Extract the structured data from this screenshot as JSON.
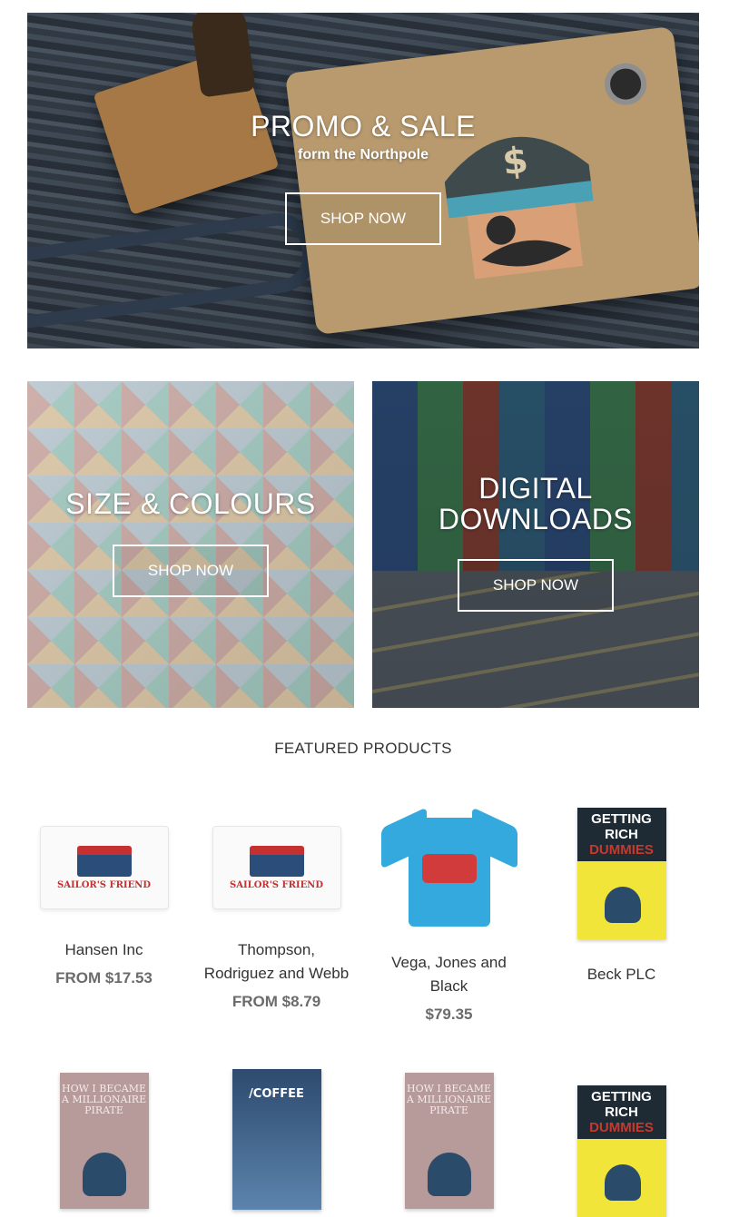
{
  "hero": {
    "title": "PROMO & SALE",
    "subtitle": "form the Northpole",
    "button": "SHOP NOW"
  },
  "tiles": [
    {
      "title": "SIZE & COLOURS",
      "button": "SHOP NOW"
    },
    {
      "title_line1": "DIGITAL",
      "title_line2": "DOWNLOADS",
      "button": "SHOP NOW"
    }
  ],
  "featured": {
    "title": "FEATURED PRODUCTS",
    "products": [
      {
        "name": "Hansen Inc",
        "price": "FROM $17.53",
        "image": "sailors-friend-package"
      },
      {
        "name_line1": "Thompson,",
        "name_line2": "Rodriguez and Webb",
        "price": "FROM $8.79",
        "image": "sailors-friend-package"
      },
      {
        "name_line1": "Vega, Jones and",
        "name_line2": "Black",
        "price": "$79.35",
        "image": "blue-tshirt"
      },
      {
        "name": "Beck PLC",
        "image": "getting-rich-book"
      }
    ],
    "second_row": [
      {
        "image": "millionaire-pirate-book",
        "book_title": "HOW I BECAME A MILLIONAIRE PIRATE"
      },
      {
        "image": "coffee-bag",
        "bag_title": "/COFFEE"
      },
      {
        "image": "millionaire-pirate-book",
        "book_title": "HOW I BECAME A MILLIONAIRE PIRATE"
      },
      {
        "image": "getting-rich-book"
      }
    ],
    "rich_book": {
      "line1": "GETTING",
      "line2": "RICH",
      "line3": "DUMMIES"
    },
    "package_logo": "SAILOR'S FRIEND"
  }
}
